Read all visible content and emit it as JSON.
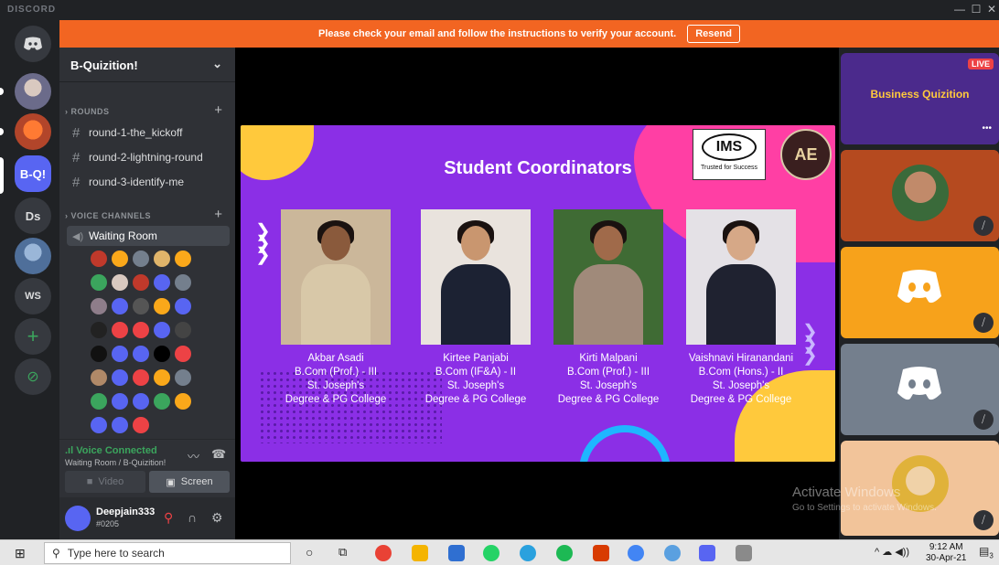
{
  "window": {
    "brand": "DISCORD",
    "minimize": "—",
    "maximize": "☐",
    "close": "✕"
  },
  "servers": [
    {
      "label": "",
      "kind": "home"
    },
    {
      "label": "",
      "kind": "avatar"
    },
    {
      "label": "",
      "kind": "avatar"
    },
    {
      "label": "B-Q!",
      "kind": "text"
    },
    {
      "label": "Ds",
      "kind": "text"
    },
    {
      "label": "",
      "kind": "avatar"
    },
    {
      "label": "WS",
      "kind": "text"
    },
    {
      "label": "+",
      "kind": "add"
    },
    {
      "label": "⊘",
      "kind": "explore"
    }
  ],
  "banner": {
    "message": "Please check your email and follow the instructions to verify your account.",
    "resend": "Resend"
  },
  "guild": {
    "name": "B-Quizition!"
  },
  "categories": {
    "rounds": "ROUNDS",
    "voice": "VOICE CHANNELS"
  },
  "text_channels": [
    "round-1-the_kickoff",
    "round-2-lightning-round",
    "round-3-identify-me"
  ],
  "voice_channel": {
    "name": "Waiting Room"
  },
  "voice_connection": {
    "status": "Voice Connected",
    "location": "Waiting Room / B-Quizition!",
    "video": "Video",
    "screen": "Screen"
  },
  "user": {
    "name": "Deepjain333",
    "tag": "#0205"
  },
  "slide": {
    "title": "Student Coordinators",
    "ims_logo": "IMS",
    "ims_tagline": "Trusted for Success",
    "ace_logo": "AE",
    "coordinators": [
      {
        "name": "Akbar Asadi",
        "course": "B.Com (Prof.) - III",
        "college1": "St. Joseph's",
        "college2": "Degree & PG College"
      },
      {
        "name": "Kirtee Panjabi",
        "course": "B.Com (IF&A) - II",
        "college1": "St. Joseph's",
        "college2": "Degree & PG College"
      },
      {
        "name": "Kirti Malpani",
        "course": "B.Com (Prof.) - III",
        "college1": "St. Joseph's",
        "college2": "Degree & PG College"
      },
      {
        "name": "Vaishnavi Hiranandani",
        "course": "B.Com (Hons.) - II",
        "college1": "St. Joseph's",
        "college2": "Degree & PG College"
      }
    ]
  },
  "tiles": {
    "live_badge": "LIVE",
    "stream_title": "Business Quizition",
    "more": "•••"
  },
  "watermark": {
    "line1": "Activate Windows",
    "line2": "Go to Settings to activate Windows."
  },
  "taskbar": {
    "search_placeholder": "Type here to search",
    "time": "9:12 AM",
    "date": "30-Apr-21",
    "notifications": "3"
  },
  "colors": {
    "banner": "#f26522",
    "blurple": "#5865f2",
    "green": "#3ba55d",
    "slide_purple": "#8b2fe6",
    "tile_orange": "#f7a21b",
    "tile_gray": "#747f8d"
  }
}
